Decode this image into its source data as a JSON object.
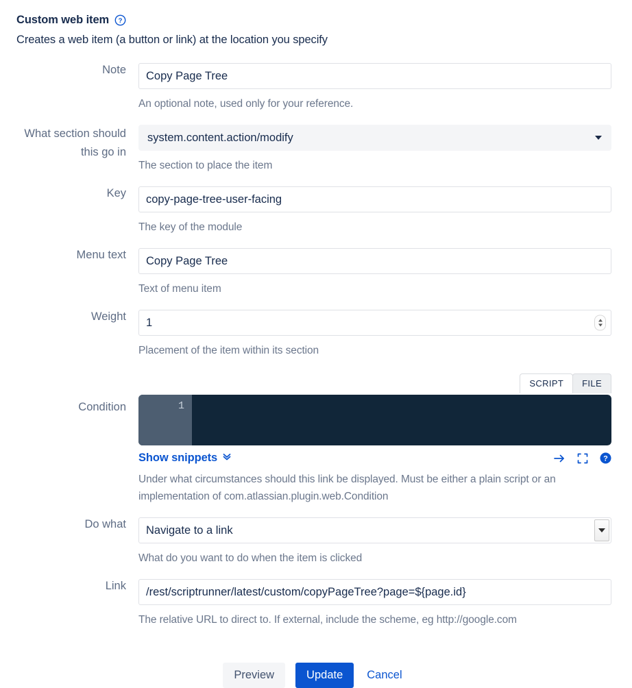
{
  "header": {
    "title": "Custom web item",
    "help_icon": "help-circle-icon",
    "subtitle": "Creates a web item (a button or link) at the location you specify"
  },
  "fields": {
    "note": {
      "label": "Note",
      "value": "Copy Page Tree",
      "placeholder": "",
      "description": "An optional note, used only for your reference."
    },
    "section": {
      "label": "What section should this go in",
      "value": "system.content.action/modify",
      "description": "The section to place the item",
      "caret_icon": "chevron-down-icon"
    },
    "key": {
      "label": "Key",
      "value": "copy-page-tree-user-facing",
      "placeholder": "",
      "description": "The key of the module"
    },
    "menu_text": {
      "label": "Menu text",
      "value": "Copy Page Tree",
      "placeholder": "",
      "description": "Text of menu item"
    },
    "weight": {
      "label": "Weight",
      "value": "1",
      "placeholder": "",
      "description": "Placement of the item within its section",
      "spinner_icon": "number-stepper-icon"
    },
    "condition": {
      "label": "Condition",
      "tabs": [
        {
          "label": "SCRIPT",
          "active": true
        },
        {
          "label": "FILE",
          "active": false
        }
      ],
      "line_number": "1",
      "code": "",
      "snippets_label": "Show snippets",
      "snippets_caret_icon": "chevron-double-down-icon",
      "toolbar_icons": [
        "arrow-right-icon",
        "fullscreen-icon",
        "help-circle-filled-icon"
      ],
      "description": "Under what circumstances should this link be displayed. Must be either a plain script or an implementation of com.atlassian.plugin.web.Condition"
    },
    "do_what": {
      "label": "Do what",
      "value": "Navigate to a link",
      "description": "What do you want to do when the item is clicked",
      "caret_icon": "chevron-down-icon"
    },
    "link": {
      "label": "Link",
      "value": "/rest/scriptrunner/latest/custom/copyPageTree?page=${page.id}",
      "placeholder": "",
      "description": "The relative URL to direct to. If external, include the scheme, eg http://google.com"
    }
  },
  "actions": {
    "preview": "Preview",
    "update": "Update",
    "cancel": "Cancel"
  },
  "colors": {
    "accent_blue": "#0B55D0",
    "label_gray": "#5E6C84",
    "desc_gray": "#6B778C",
    "editor_bg": "#112639",
    "gutter_bg": "#4D5E71",
    "select_bg": "#F4F5F7",
    "text_dark": "#172B4D"
  }
}
